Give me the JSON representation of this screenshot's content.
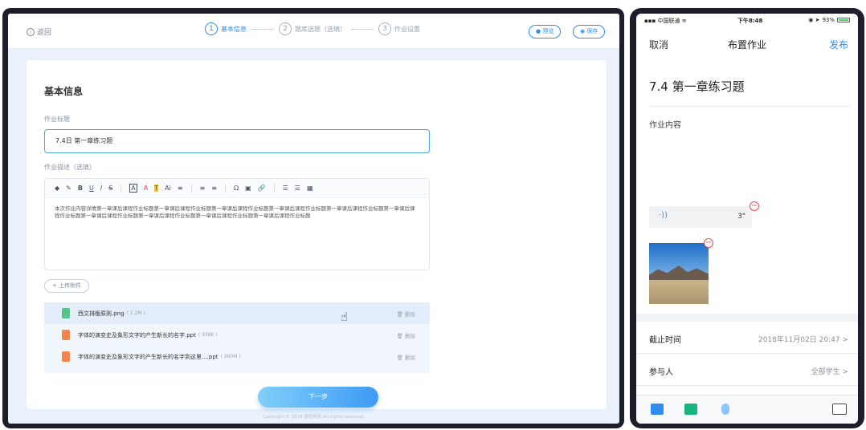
{
  "desktop": {
    "back_label": "返回",
    "steps": [
      {
        "num": "1",
        "label": "基本信息"
      },
      {
        "num": "2",
        "label": "题库选题（选填）"
      },
      {
        "num": "3",
        "label": "作业设置"
      }
    ],
    "preview_label": "预览",
    "save_label": "保存",
    "section_title": "基本信息",
    "title_label": "作业标题",
    "title_value": "7.4日 第一章练习题",
    "desc_label": "作业描述（选填）",
    "toolbar_buttons": [
      "B",
      "U",
      "I",
      "S",
      "A",
      "A",
      "T",
      "Ai",
      "≡",
      "≡",
      "≡",
      "Ω",
      "▣",
      "🔗",
      "☰",
      "☰",
      "▦"
    ],
    "editor_text": "本次作业内容详情第一章课后课程作业标题第一章课后课程作业标题第一章课后课程作业标题第一章课后课程作业标题第一章课后课程作业标题第一章课后课程作业标题第一章课后课程作业标题第一章课后课程作业标题第一章课后课程作业标题第一章课后课程作业标题",
    "upload_label": "+ 上传附件",
    "files": [
      {
        "type": "png",
        "name": "西文排版原则.png",
        "size": "( 1.2M )",
        "action": "删除"
      },
      {
        "type": "ppt",
        "name": "字体的演变史及象形文字的产生新长的名字.ppt",
        "size": "( 938K )",
        "action": "删除"
      },
      {
        "type": "ppt",
        "name": "字体的演变史及象形文字的产生新长的名字到这里....ppt",
        "size": "( 260M )",
        "action": "删除"
      }
    ],
    "next_label": "下一步",
    "copyright": "Copyright © 2024 版权所有 All rights reserved."
  },
  "phone": {
    "carrier": "中国联通",
    "time": "下午8:48",
    "battery": "93%",
    "cancel": "取消",
    "title": "布置作业",
    "publish": "发布",
    "homework_title": "7.4 第一章练习题",
    "content_label": "作业内容",
    "audio_duration": "3\"",
    "deadline_label": "截止时间",
    "deadline_value": "2018年11月02日 20:47 >",
    "participants_label": "参与人",
    "participants_value": "全部学生 >"
  },
  "colors": {
    "accent": "#2f8cf0",
    "frame": "#1e1d2c",
    "desk_bg": "#eaf1fa"
  }
}
